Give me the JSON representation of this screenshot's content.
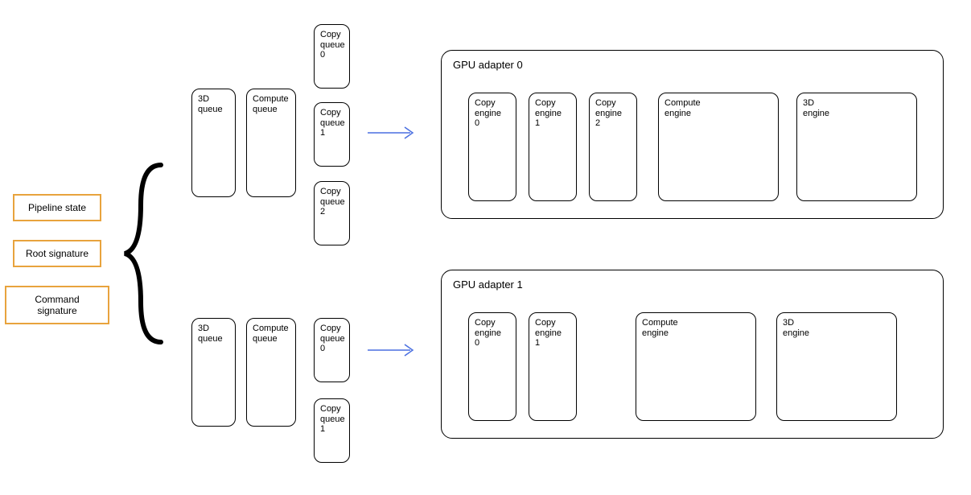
{
  "left_items": {
    "pipeline_state": "Pipeline state",
    "root_signature": "Root signature",
    "command_signature": "Command signature"
  },
  "queues": {
    "three_d": "3D\nqueue",
    "compute": "Compute\nqueue",
    "copy0": "Copy\nqueue\n0",
    "copy1": "Copy\nqueue\n1",
    "copy2": "Copy\nqueue\n2"
  },
  "adapters": {
    "a0": {
      "title": "GPU adapter 0",
      "engines": {
        "copy0": "Copy\nengine\n0",
        "copy1": "Copy\nengine\n1",
        "copy2": "Copy\nengine\n2",
        "compute": "Compute\nengine",
        "three_d": "3D\nengine"
      }
    },
    "a1": {
      "title": "GPU adapter 1",
      "engines": {
        "copy0": "Copy\nengine\n0",
        "copy1": "Copy\nengine\n1",
        "compute": "Compute\nengine",
        "three_d": "3D\nengine"
      }
    }
  }
}
